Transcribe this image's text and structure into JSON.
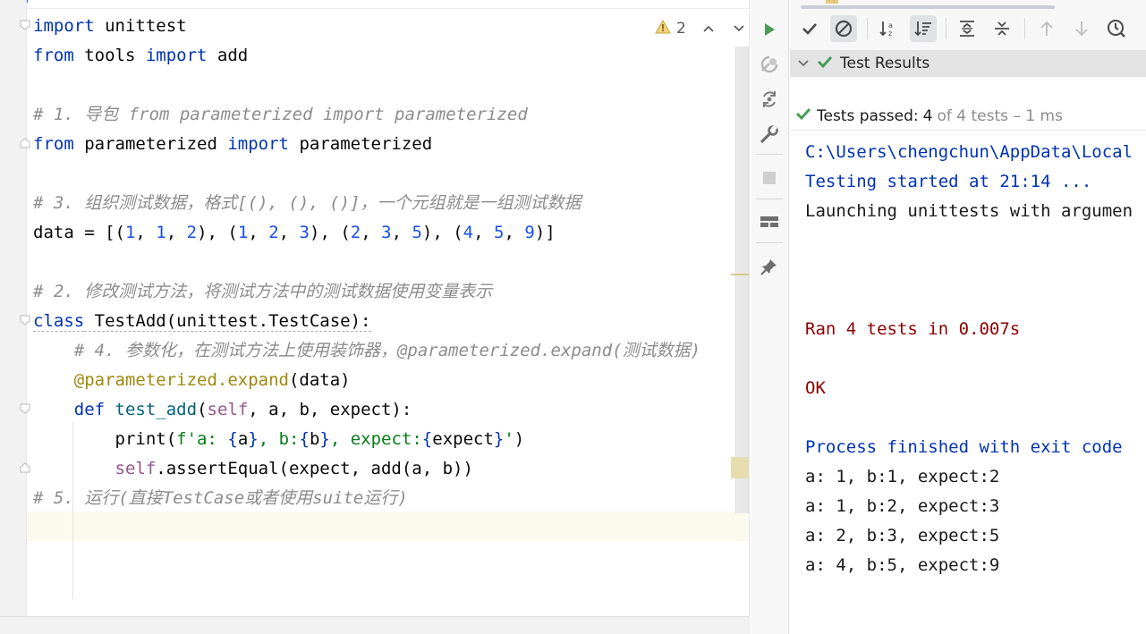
{
  "editor": {
    "inspection": {
      "warning_count": "2"
    },
    "lines": [
      {
        "parts": [
          {
            "t": "import",
            "c": "kw"
          },
          {
            "t": " unittest",
            "c": ""
          }
        ]
      },
      {
        "parts": [
          {
            "t": "from",
            "c": "kw"
          },
          {
            "t": " tools ",
            "c": ""
          },
          {
            "t": "import",
            "c": "kw"
          },
          {
            "t": " add",
            "c": ""
          }
        ]
      },
      {
        "parts": []
      },
      {
        "parts": [
          {
            "t": "# 1. 导包 from parameterized import parameterized",
            "c": "cmt"
          }
        ]
      },
      {
        "parts": [
          {
            "t": "from",
            "c": "kw"
          },
          {
            "t": " parameterized ",
            "c": ""
          },
          {
            "t": "import",
            "c": "kw"
          },
          {
            "t": " parameterized",
            "c": ""
          }
        ]
      },
      {
        "parts": []
      },
      {
        "parts": [
          {
            "t": "# 3. 组织测试数据，格式[(), (), ()]，一个元组就是一组测试数据",
            "c": "cmt"
          }
        ]
      },
      {
        "parts": [
          {
            "t": "data = [(",
            "c": ""
          },
          {
            "t": "1",
            "c": "num"
          },
          {
            "t": ", ",
            "c": ""
          },
          {
            "t": "1",
            "c": "num"
          },
          {
            "t": ", ",
            "c": ""
          },
          {
            "t": "2",
            "c": "num"
          },
          {
            "t": "), (",
            "c": ""
          },
          {
            "t": "1",
            "c": "num"
          },
          {
            "t": ", ",
            "c": ""
          },
          {
            "t": "2",
            "c": "num"
          },
          {
            "t": ", ",
            "c": ""
          },
          {
            "t": "3",
            "c": "num"
          },
          {
            "t": "), (",
            "c": ""
          },
          {
            "t": "2",
            "c": "num"
          },
          {
            "t": ", ",
            "c": ""
          },
          {
            "t": "3",
            "c": "num"
          },
          {
            "t": ", ",
            "c": ""
          },
          {
            "t": "5",
            "c": "num"
          },
          {
            "t": "), (",
            "c": ""
          },
          {
            "t": "4",
            "c": "num"
          },
          {
            "t": ", ",
            "c": ""
          },
          {
            "t": "5",
            "c": "num"
          },
          {
            "t": ", ",
            "c": ""
          },
          {
            "t": "9",
            "c": "num"
          },
          {
            "t": ")]",
            "c": ""
          }
        ]
      },
      {
        "parts": []
      },
      {
        "parts": [
          {
            "t": "# 2. 修改测试方法，将测试方法中的测试数据使用变量表示",
            "c": "cmt"
          }
        ]
      },
      {
        "parts": [
          {
            "t": "class",
            "c": "kw under"
          },
          {
            "t": " TestAdd(unittest.TestCase):",
            "c": "under"
          }
        ]
      },
      {
        "parts": [
          {
            "t": "    # 4. 参数化，在测试方法上使用装饰器，@parameterized.expand(测试数据)",
            "c": "cmt"
          }
        ]
      },
      {
        "parts": [
          {
            "t": "    ",
            "c": ""
          },
          {
            "t": "@parameterized.expand",
            "c": "dec"
          },
          {
            "t": "(data)",
            "c": ""
          }
        ]
      },
      {
        "parts": [
          {
            "t": "    ",
            "c": ""
          },
          {
            "t": "def",
            "c": "kw"
          },
          {
            "t": " ",
            "c": ""
          },
          {
            "t": "test_add",
            "c": "fn"
          },
          {
            "t": "(",
            "c": ""
          },
          {
            "t": "self",
            "c": "slf"
          },
          {
            "t": ", a, b, expect):",
            "c": ""
          }
        ]
      },
      {
        "parts": [
          {
            "t": "        print(",
            "c": ""
          },
          {
            "t": "f'a: ",
            "c": "str"
          },
          {
            "t": "{",
            "c": "kw"
          },
          {
            "t": "a",
            "c": ""
          },
          {
            "t": "}",
            "c": "kw"
          },
          {
            "t": ", b:",
            "c": "str"
          },
          {
            "t": "{",
            "c": "kw"
          },
          {
            "t": "b",
            "c": ""
          },
          {
            "t": "}",
            "c": "kw"
          },
          {
            "t": ", expect:",
            "c": "str"
          },
          {
            "t": "{",
            "c": "kw"
          },
          {
            "t": "expect",
            "c": ""
          },
          {
            "t": "}",
            "c": "kw"
          },
          {
            "t": "'",
            "c": "str"
          },
          {
            "t": ")",
            "c": ""
          }
        ]
      },
      {
        "parts": [
          {
            "t": "        ",
            "c": ""
          },
          {
            "t": "self",
            "c": "slf"
          },
          {
            "t": ".assertEqual(expect, add(a, b))",
            "c": ""
          }
        ]
      },
      {
        "parts": [
          {
            "t": "# 5. 运行(直接TestCase或者使用suite运行)",
            "c": "cmt"
          }
        ]
      }
    ]
  },
  "results": {
    "title": "Test Results",
    "passed_label": "Tests passed:",
    "passed_count": "4",
    "passed_detail": "of 4 tests – 1 ms"
  },
  "console": [
    {
      "text": "C:\\Users\\chengchun\\AppData\\Local",
      "color": "c-blue"
    },
    {
      "text": "Testing started at 21:14 ...",
      "color": "c-blue"
    },
    {
      "text": "Launching unittests with argumen",
      "color": "c-dark"
    },
    {
      "text": "",
      "color": "c-dark"
    },
    {
      "text": "",
      "color": "c-dark"
    },
    {
      "text": "",
      "color": "c-dark"
    },
    {
      "text": "Ran 4 tests in 0.007s",
      "color": "c-red"
    },
    {
      "text": "",
      "color": "c-dark"
    },
    {
      "text": "OK",
      "color": "c-red"
    },
    {
      "text": "",
      "color": "c-dark"
    },
    {
      "text": "Process finished with exit code",
      "color": "c-blue"
    },
    {
      "text": "a: 1, b:1, expect:2",
      "color": "c-dark"
    },
    {
      "text": "a: 1, b:2, expect:3",
      "color": "c-dark"
    },
    {
      "text": "a: 2, b:3, expect:5",
      "color": "c-dark"
    },
    {
      "text": "a: 4, b:5, expect:9",
      "color": "c-dark"
    }
  ],
  "colors": {
    "keyword": "#0033b3",
    "number": "#1750eb",
    "comment": "#8c8c8c",
    "decorator": "#9e880d",
    "string": "#067d17",
    "run_green": "#499c54",
    "console_red": "#8a0000"
  }
}
